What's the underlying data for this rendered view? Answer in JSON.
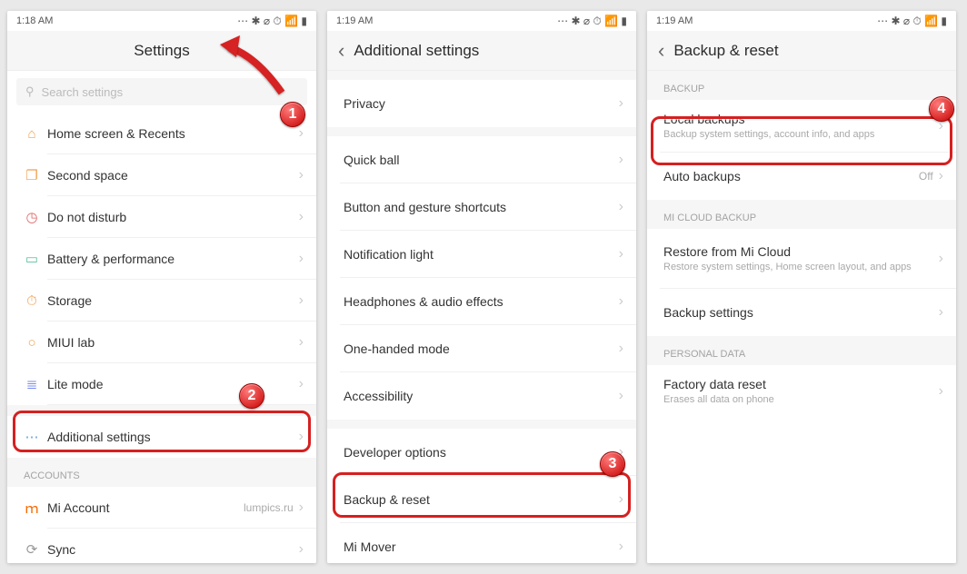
{
  "status": {
    "time_a": "1:18  AM",
    "time_b": "1:19  AM",
    "time_c": "1:19  AM",
    "icons": "⋯  ✱ ⌀ ⏱ 📶 ▮"
  },
  "screen1": {
    "title": "Settings",
    "search_placeholder": "Search settings",
    "items": [
      {
        "icon": "⌂",
        "cls": "ic-home",
        "label": "Home screen & Recents"
      },
      {
        "icon": "❐",
        "cls": "ic-second",
        "label": "Second space"
      },
      {
        "icon": "◷",
        "cls": "ic-dnd",
        "label": "Do not disturb"
      },
      {
        "icon": "▭",
        "cls": "ic-batt",
        "label": "Battery & performance"
      },
      {
        "icon": "⏱",
        "cls": "ic-store",
        "label": "Storage"
      },
      {
        "icon": "○",
        "cls": "ic-lab",
        "label": "MIUI lab"
      },
      {
        "icon": "≣",
        "cls": "ic-lite",
        "label": "Lite mode"
      },
      {
        "icon": "⋯",
        "cls": "ic-more",
        "label": "Additional settings"
      }
    ],
    "accounts_head": "ACCOUNTS",
    "mi_account": {
      "icon": "ｍ",
      "cls": "ic-mi",
      "label": "Mi Account",
      "value": "lumpics.ru"
    },
    "sync": {
      "icon": "⟳",
      "cls": "",
      "label": "Sync"
    }
  },
  "screen2": {
    "title": "Additional  settings",
    "items": [
      "Privacy",
      "Quick ball",
      "Button and gesture shortcuts",
      "Notification light",
      "Headphones & audio effects",
      "One-handed mode",
      "Accessibility",
      "Developer options",
      "Backup & reset",
      "Mi Mover"
    ]
  },
  "screen3": {
    "title": "Backup  &  reset",
    "backup_head": "BACKUP",
    "local": {
      "label": "Local backups",
      "sub": "Backup system settings, account info, and apps"
    },
    "auto": {
      "label": "Auto backups",
      "value": "Off"
    },
    "micloud_head": "MI CLOUD BACKUP",
    "restore": {
      "label": "Restore from Mi Cloud",
      "sub": "Restore system settings, Home screen layout, and apps"
    },
    "backup_settings": {
      "label": "Backup settings"
    },
    "personal_head": "PERSONAL DATA",
    "factory": {
      "label": "Factory data reset",
      "sub": "Erases all data on phone"
    }
  },
  "badges": {
    "b1": "1",
    "b2": "2",
    "b3": "3",
    "b4": "4"
  }
}
